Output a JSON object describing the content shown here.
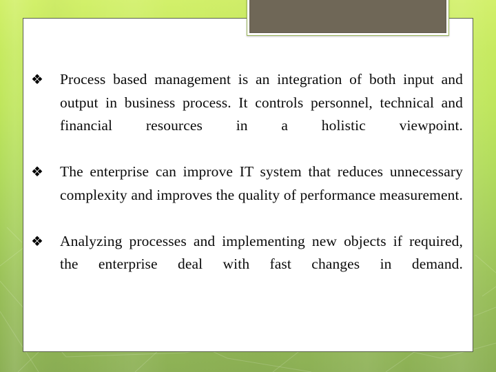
{
  "slide": {
    "background": {
      "gradient_top_color": "#d2f06a",
      "gradient_bottom_color": "#8cb055"
    },
    "panel": {
      "background_color": "#ffffff",
      "border_color": "#58604a"
    },
    "picture_placeholder": {
      "name": "image-placeholder",
      "fill_color": "#6f6757",
      "frame_color": "#ffffff",
      "outline_color": "#9ab558"
    },
    "bullets": [
      {
        "marker": "❖",
        "text": "Process based management is an integration of both input and output in business process. It controls personnel, technical and financial resources in a holistic viewpoint."
      },
      {
        "marker": "❖",
        "text": "The enterprise can improve IT system that reduces unnecessary complexity and improves the quality of performance measurement."
      },
      {
        "marker": "❖",
        "text": "Analyzing processes and implementing new objects if required, the enterprise deal with fast changes in demand."
      }
    ]
  }
}
